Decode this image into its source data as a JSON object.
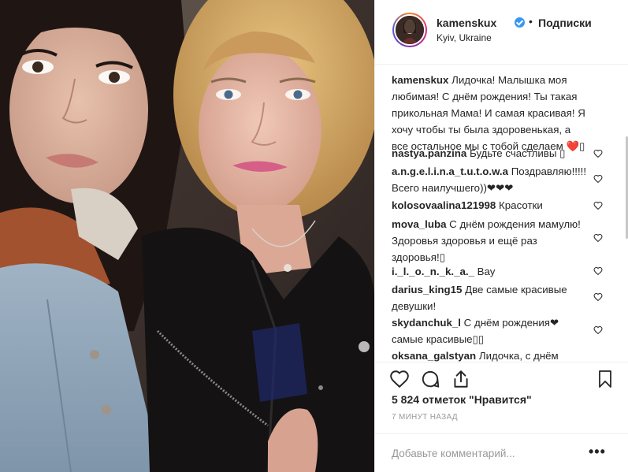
{
  "post": {
    "username": "kamenskux",
    "separator": "•",
    "follow_label": "Подписки",
    "location": "Kyiv, Ukraine",
    "icons": {
      "verified": "verified-badge-icon",
      "like": "heart-icon",
      "comment": "comment-icon",
      "share": "share-icon",
      "save": "bookmark-icon",
      "more": "more-options-icon"
    },
    "caption": {
      "username": "kamenskux",
      "text": "Лидочка! Малышка моя любимая! С днём рождения! Ты такая прикольная Мама! И самая красивая! Я хочу чтобы ты была здоровенькая, а все остальное мы с тобой сделаем ❤️▯"
    },
    "comments": [
      {
        "username": "nastya.panzina",
        "text": "Будьте счастливы ▯"
      },
      {
        "username": "a.n.g.e.l.i.n.a_t.u.t.o.w.a",
        "text": "Поздравляю!!!!! Всего наилучшего))❤❤❤"
      },
      {
        "username": "kolosovaalina121998",
        "text": "Красотки"
      },
      {
        "username": "mova_luba",
        "text": "С днём рождения мамулю! Здоровья здоровья и ещё раз здоровья!▯"
      },
      {
        "username": "i._l._o._n._k._a._",
        "text": "Вау"
      },
      {
        "username": "darius_king15",
        "text": "Две самые красивые девушки!"
      },
      {
        "username": "skydanchuk_l",
        "text": "С днём рождения❤ самые красивые▯▯"
      },
      {
        "username": "oksana_galstyan",
        "text": "Лидочка, с днём"
      }
    ],
    "likes_label": "5 824 отметок \"Нравится\"",
    "time_label": "7 МИНУТ НАЗАД",
    "add_comment_placeholder": "Добавьте комментарий...",
    "more_label": "•••",
    "colors": {
      "verified": "#3897f0",
      "text": "#262626",
      "muted": "#999999",
      "border": "#efefef"
    }
  }
}
